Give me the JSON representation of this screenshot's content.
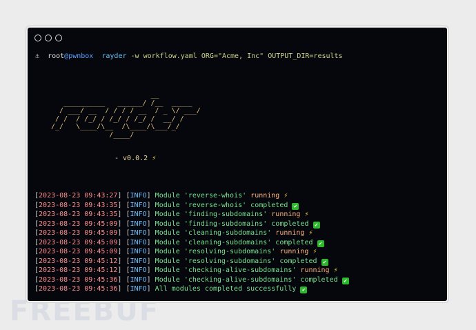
{
  "window": {
    "controls": [
      "close",
      "minimize",
      "maximize"
    ]
  },
  "prompt": {
    "icon": "anchor-icon",
    "symbol": "⚓",
    "user": "root",
    "at": "@",
    "host": "pwnbox",
    "command": "rayder",
    "args": "-w workflow.yaml ORG=\"Acme, Inc\" OUTPUT_DIR=results"
  },
  "banner": {
    "ascii": "                         __\n    __________   ______/ /__  _____\n   / ___/ __  / / / / __  / _ \\/ ___/\n  / /  / /_/ / /_/ / /_/ /  __/ /\n /_/   \\____/\\__  /\\____/\\___/_/\n               /____/",
    "version": "- v0.0.2",
    "version_icon": "lightning-icon",
    "version_emoji": "⚡"
  },
  "log": [
    {
      "ts": "2023-08-23 09:43:27",
      "level": "INFO",
      "prefix": "Module",
      "module": "'reverse-whois'",
      "status": "running",
      "icon": "⚡"
    },
    {
      "ts": "2023-08-23 09:43:35",
      "level": "INFO",
      "prefix": "Module",
      "module": "'reverse-whois'",
      "status": "completed",
      "icon": "✔"
    },
    {
      "ts": "2023-08-23 09:43:35",
      "level": "INFO",
      "prefix": "Module",
      "module": "'finding-subdomains'",
      "status": "running",
      "icon": "⚡"
    },
    {
      "ts": "2023-08-23 09:45:09",
      "level": "INFO",
      "prefix": "Module",
      "module": "'finding-subdomains'",
      "status": "completed",
      "icon": "✔"
    },
    {
      "ts": "2023-08-23 09:45:09",
      "level": "INFO",
      "prefix": "Module",
      "module": "'cleaning-subdomains'",
      "status": "running",
      "icon": "⚡"
    },
    {
      "ts": "2023-08-23 09:45:09",
      "level": "INFO",
      "prefix": "Module",
      "module": "'cleaning-subdomains'",
      "status": "completed",
      "icon": "✔"
    },
    {
      "ts": "2023-08-23 09:45:09",
      "level": "INFO",
      "prefix": "Module",
      "module": "'resolving-subdomains'",
      "status": "running",
      "icon": "⚡"
    },
    {
      "ts": "2023-08-23 09:45:12",
      "level": "INFO",
      "prefix": "Module",
      "module": "'resolving-subdomains'",
      "status": "completed",
      "icon": "✔"
    },
    {
      "ts": "2023-08-23 09:45:12",
      "level": "INFO",
      "prefix": "Module",
      "module": "'checking-alive-subdomains'",
      "status": "running",
      "icon": "⚡"
    },
    {
      "ts": "2023-08-23 09:45:36",
      "level": "INFO",
      "prefix": "Module",
      "module": "'checking-alive-subdomains'",
      "status": "completed",
      "icon": "✔"
    },
    {
      "ts": "2023-08-23 09:45:36",
      "level": "INFO",
      "prefix": "",
      "module": "",
      "status": "All modules completed successfully",
      "icon": "✔"
    }
  ],
  "watermark": "FREEBUF",
  "colors": {
    "terminal_bg": "#05070d",
    "timestamp": "#ff8c8c",
    "info": "#6fc3ff",
    "success": "#78e08f",
    "running": "#ffb37a",
    "banner": "#e3c27b"
  }
}
